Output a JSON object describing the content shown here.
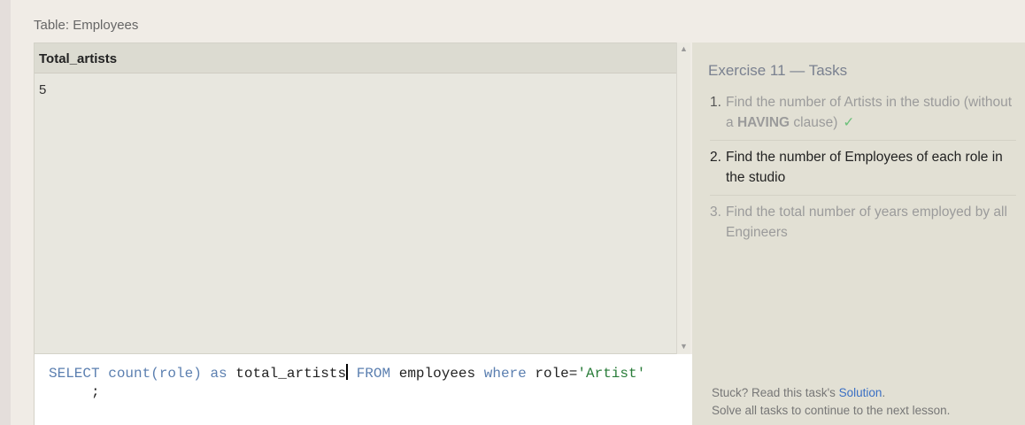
{
  "table_caption": "Table: Employees",
  "results": {
    "columns": [
      "Total_artists"
    ],
    "rows": [
      [
        "5"
      ]
    ]
  },
  "editor": {
    "kw_select": "SELECT",
    "fn_count": "count(role)",
    "kw_as": "as",
    "alias": "total_artists",
    "kw_from": "FROM",
    "table": "employees",
    "kw_where": "where",
    "cond_lhs": "role=",
    "cond_value": "'Artist'",
    "terminator": ";"
  },
  "tasks": {
    "title": "Exercise 11 — Tasks",
    "items": [
      {
        "number": "1.",
        "text_a": "Find the number of Artists in the studio (without a ",
        "text_bold": "HAVING",
        "text_b": " clause)",
        "status": "✓"
      },
      {
        "number": "2.",
        "text": "Find the number of Employees of each role in the studio"
      },
      {
        "number": "3.",
        "text": "Find the total number of years employed by all Engineers"
      }
    ]
  },
  "footer": {
    "stuck_prefix": "Stuck? Read this task's ",
    "solution_link": "Solution",
    "stuck_suffix": ".",
    "continue_text": "Solve all tasks to continue to the next lesson."
  },
  "colors": {
    "keyword": "#5b7fb0",
    "string": "#2a7d3a",
    "check": "#6cc07a",
    "link": "#3a6fc4"
  }
}
